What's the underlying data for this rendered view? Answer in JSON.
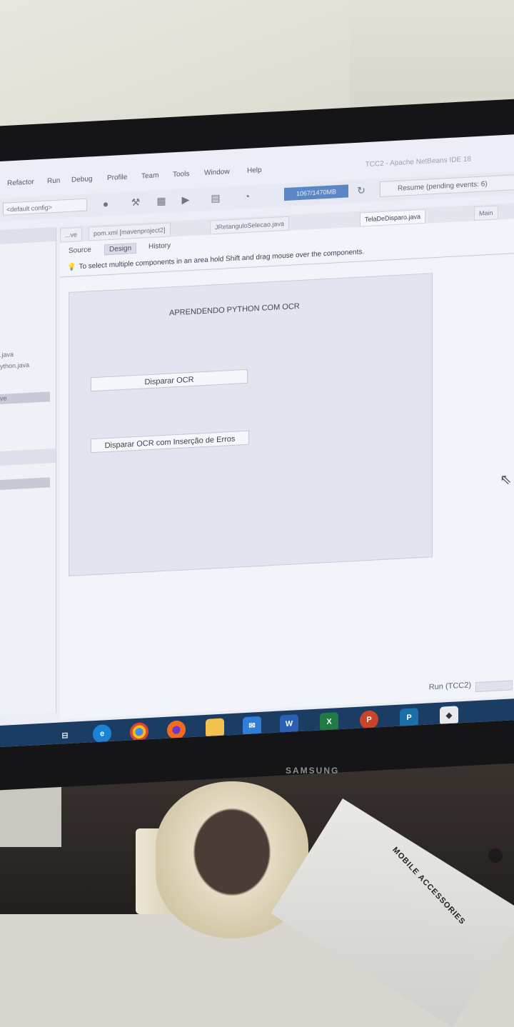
{
  "window": {
    "title": "TCC2 - Apache NetBeans IDE 18"
  },
  "menu": {
    "items": [
      "Refactor",
      "Run",
      "Debug",
      "Profile",
      "Team",
      "Tools",
      "Window",
      "Help"
    ]
  },
  "toolbar": {
    "config_select": "<default config>",
    "memory": "1067/1470MB",
    "resume": "Resume (pending events: 6)"
  },
  "left_panel": {
    "items": [
      ".java",
      "ython.java",
      "ve"
    ]
  },
  "editor": {
    "tabs": [
      "...ve",
      "pom.xml [mavenproject2]",
      "JRetanguloSelecao.java",
      "TelaDeDisparo.java",
      "Main"
    ],
    "active_tab": "TelaDeDisparo.java",
    "subtabs": [
      "Source",
      "Design",
      "History"
    ],
    "hint": "To select multiple components in an area hold Shift and drag mouse over the components."
  },
  "form": {
    "title": "APRENDENDO PYTHON COM OCR",
    "button1": "Disparar OCR",
    "button2": "Disparar OCR com Inserção de Erros"
  },
  "status": {
    "run": "Run (TCC2)"
  },
  "taskbar": {
    "apps": [
      "task-view",
      "edge",
      "chrome",
      "firefox",
      "file-explorer",
      "mail",
      "W",
      "X",
      "P",
      "P",
      "app"
    ]
  },
  "monitor": {
    "brand": "SAMSUNG"
  },
  "props": {
    "bag_label": "MOBILE ACCESSORIES"
  }
}
